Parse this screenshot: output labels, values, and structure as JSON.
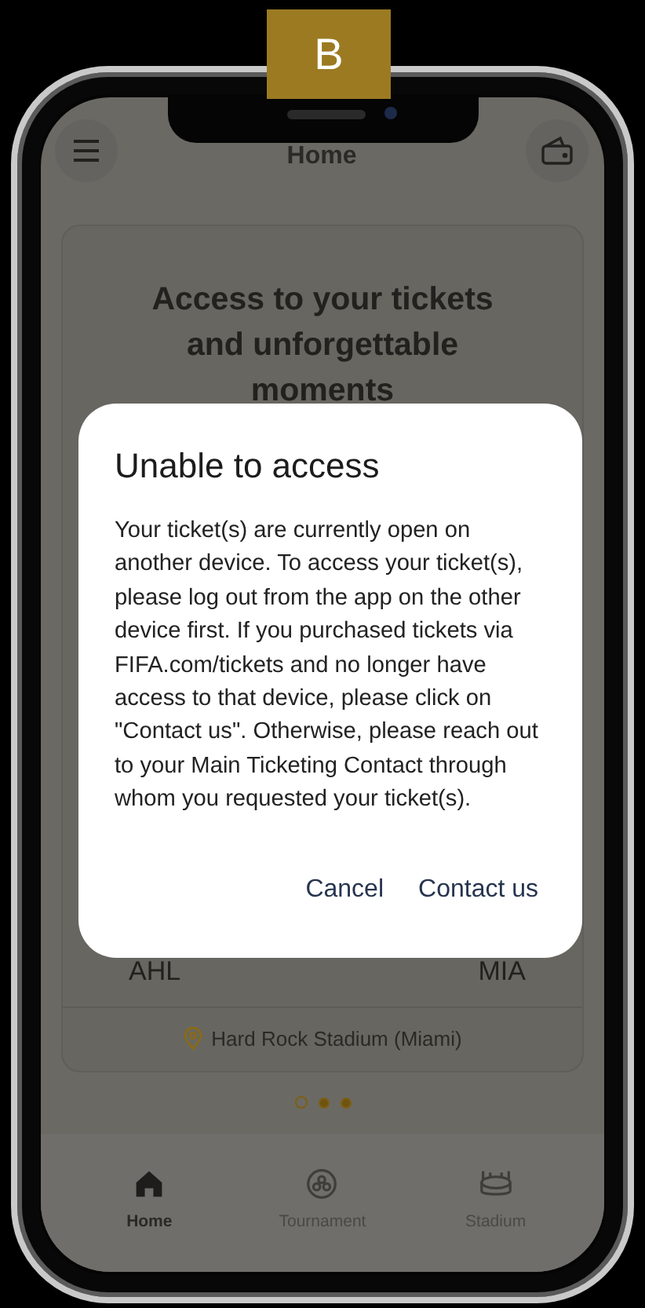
{
  "badge": "B",
  "header": {
    "title": "Home"
  },
  "hero": {
    "headline": "Access to your tickets and unforgettable moments"
  },
  "match": {
    "home_team": "AHL",
    "away_team": "MIA",
    "venue": "Hard Rock Stadium (Miami)"
  },
  "pager": [
    {
      "selected": true
    },
    {
      "selected": false
    },
    {
      "selected": false
    }
  ],
  "nav": [
    {
      "kind": "home",
      "label": "Home",
      "selected": true
    },
    {
      "kind": "tournament",
      "label": "Tournament",
      "selected": false
    },
    {
      "kind": "stadium",
      "label": "Stadium",
      "selected": false
    }
  ],
  "dialog": {
    "title": "Unable to access",
    "message": "Your ticket(s) are currently open on another device. To access your ticket(s), please log out from the app on the other device first. If you purchased tickets via FIFA.com/tickets and no longer have access to that device, please click on \"Contact us\". Otherwise, please reach out to your Main Ticketing Contact through whom you requested your ticket(s).",
    "buttons": [
      "Cancel",
      "Contact us"
    ]
  }
}
